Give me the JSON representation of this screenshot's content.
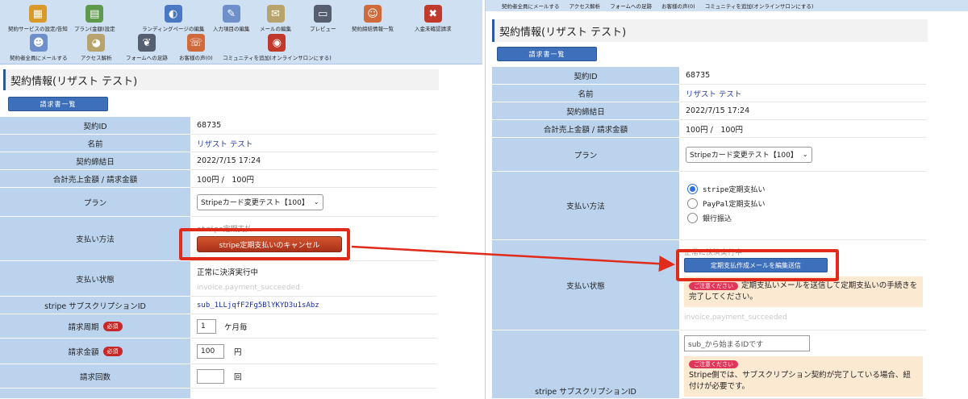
{
  "left": {
    "toolbar_row1": [
      {
        "label": "契約サービスの設定/告知",
        "icon": "settings-doc-icon"
      },
      {
        "label": "プラン(金額)設定",
        "icon": "plan-icon"
      },
      {
        "label": "ランディングページの編集",
        "icon": "landing-icon"
      },
      {
        "label": "入力項目の編集",
        "icon": "form-edit-icon"
      },
      {
        "label": "メールの編集",
        "icon": "mail-icon"
      },
      {
        "label": "プレビュー",
        "icon": "monitor-icon"
      },
      {
        "label": "契約締結情報一覧",
        "icon": "users-icon"
      },
      {
        "label": "入金未確認請求",
        "icon": "alert-user-icon"
      }
    ],
    "toolbar_row2": [
      {
        "label": "契約者全員にメールする",
        "icon": "group-mail-icon"
      },
      {
        "label": "アクセス解析",
        "icon": "pie-icon"
      },
      {
        "label": "フォームへの足跡",
        "icon": "footprint-icon"
      },
      {
        "label": "お客様の声(0)",
        "icon": "voice-icon"
      },
      {
        "label": "コミュニティを追加(オンラインサロンにする)",
        "icon": "chat-icon"
      }
    ],
    "section_title": "契約情報(リザスト テスト)",
    "invoice_button": "請求書一覧",
    "rows": {
      "contract_id": {
        "label": "契約ID",
        "value": "68735"
      },
      "name": {
        "label": "名前",
        "value": "リザスト テスト"
      },
      "date": {
        "label": "契約締結日",
        "value": "2022/7/15 17:24"
      },
      "amount": {
        "label": "合計売上金額 / 請求金額",
        "value": "100円 /　100円"
      },
      "plan": {
        "label": "プラン",
        "value": "Stripeカード変更テスト【100】"
      },
      "payment": {
        "label": "支払い方法",
        "value": "stripe定期支払",
        "cancel_button": "stripe定期支払いのキャンセル"
      },
      "status": {
        "label": "支払い状態",
        "value": "正常に決済実行中",
        "sub": "invoice.payment_succeeded"
      },
      "subscription": {
        "label": "stripe サブスクリプションID",
        "value": "sub_1LLjqfF2Fg5BlYKYD3u1sAbz"
      },
      "cycle": {
        "label": "請求周期",
        "badge": "必須",
        "value": "1",
        "unit": "ケ月毎"
      },
      "billing_amount": {
        "label": "請求金額",
        "badge": "必須",
        "value": "100",
        "unit": "円"
      },
      "count": {
        "label": "請求回数",
        "value": "",
        "unit": "回"
      }
    }
  },
  "right": {
    "nav": [
      "契約者全員にメールする",
      "アクセス解析",
      "フォームへの足跡",
      "お客様の声(0)",
      "コミュニティを追加(オンラインサロンにする)"
    ],
    "section_title": "契約情報(リザスト テスト)",
    "invoice_button": "請求書一覧",
    "rows": {
      "contract_id": {
        "label": "契約ID",
        "value": "68735"
      },
      "name": {
        "label": "名前",
        "value": "リザスト テスト"
      },
      "date": {
        "label": "契約締結日",
        "value": "2022/7/15 17:24"
      },
      "amount": {
        "label": "合計売上金額 / 請求金額",
        "value": "100円 /　100円"
      },
      "plan": {
        "label": "プラン",
        "value": "Stripeカード変更テスト【100】"
      },
      "payment": {
        "label": "支払い方法",
        "options": [
          "stripe定期支払い",
          "PayPal定期支払い",
          "銀行振込"
        ],
        "selected": 0
      },
      "status": {
        "label": "支払い状態",
        "value": "正常に決済実行中",
        "send_button": "定期支払作成メールを編集送信",
        "notice_pill": "ご注意ください",
        "notice_text": "定期支払いメールを送信して定期支払いの手続きを完了してください。",
        "sub": "invoice.payment_succeeded"
      },
      "subscription": {
        "label": "stripe サブスクリプションID",
        "placeholder": "sub_から始まるIDです",
        "notice_pill": "ご注意ください",
        "notice_text": "Stripe側では、サブスクリプション契約が完了している場合、紐付けが必要です。"
      }
    }
  },
  "colors": {
    "highlight": "#e02a1a",
    "label_bg": "#bcd3ee",
    "toolbar_bg": "#cfe0f3",
    "accent": "#3d6fbb"
  }
}
